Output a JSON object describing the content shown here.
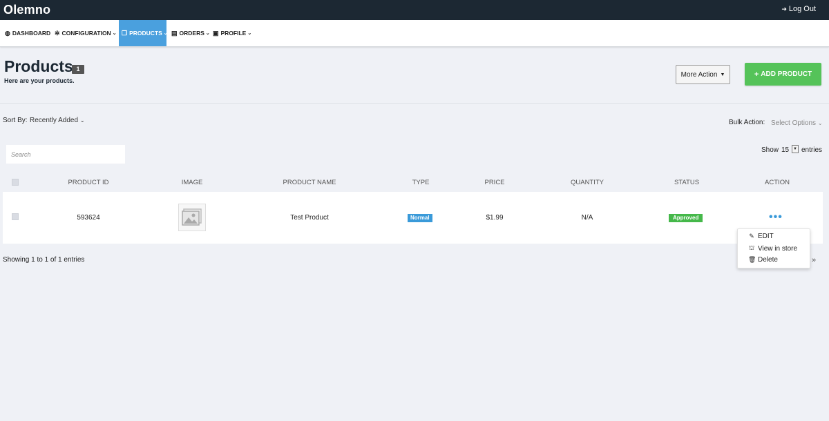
{
  "app": {
    "brand": "Olemno",
    "logout_label": "Log Out"
  },
  "nav": {
    "items": [
      {
        "label": "DASHBOARD",
        "icon": "dashboard-icon"
      },
      {
        "label": "CONFIGURATION",
        "icon": "gear-icon"
      },
      {
        "label": "PRODUCTS",
        "icon": "products-icon",
        "active": true
      },
      {
        "label": "ORDERS",
        "icon": "orders-icon"
      },
      {
        "label": "PROFILE",
        "icon": "profile-icon"
      }
    ]
  },
  "header": {
    "title": "Products",
    "count": "1",
    "subtitle": "Here are your products.",
    "more_action_label": "More Action",
    "add_product_label": "ADD PRODUCT"
  },
  "controls": {
    "sort_label": "Sort By:",
    "sort_value": "Recently Added",
    "bulk_label": "Bulk Action:",
    "bulk_value": "Select Options",
    "search_placeholder": "Search",
    "show_label": "Show",
    "show_value": "15",
    "entries_label": "entries"
  },
  "table": {
    "columns": [
      "PRODUCT ID",
      "IMAGE",
      "PRODUCT NAME",
      "TYPE",
      "PRICE",
      "QUANTITY",
      "STATUS",
      "ACTION"
    ],
    "rows": [
      {
        "product_id": "593624",
        "product_name": "Test Product",
        "type": "Normal",
        "price": "$1.99",
        "quantity": "N/A",
        "status": "Approved",
        "action": "•••"
      }
    ],
    "footer_text": "Showing 1 to 1 of 1 entries",
    "pager_next": "»"
  },
  "action_menu": {
    "items": [
      {
        "label": "EDIT",
        "icon": "pencil-icon"
      },
      {
        "label": "View in store",
        "icon": "store-icon"
      },
      {
        "label": "Delete",
        "icon": "trash-icon"
      }
    ]
  },
  "colors": {
    "topbar": "#1c2833",
    "nav_active": "#4aa0de",
    "add_button": "#55c359",
    "type_badge": "#3a9ad9",
    "status_badge": "#45b84a"
  }
}
